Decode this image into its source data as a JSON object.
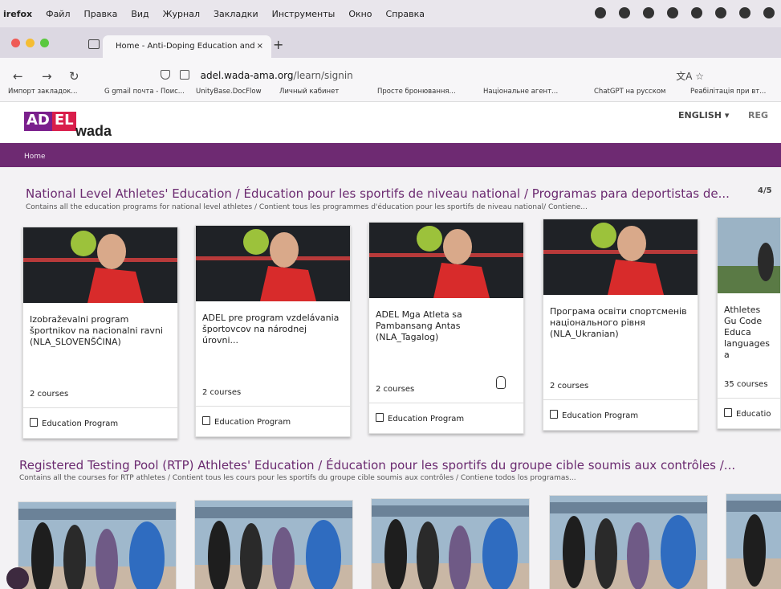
{
  "menubar": {
    "app": "irefox",
    "items": [
      "Файл",
      "Правка",
      "Вид",
      "Журнал",
      "Закладки",
      "Инструменты",
      "Окно",
      "Справка"
    ]
  },
  "browser": {
    "tab_title": "Home - Anti-Doping Education and",
    "tab_close": "×",
    "new_tab": "+",
    "url_host": "adel.wada-ama.org",
    "url_path": "/learn/signin",
    "bookmarks": [
      "Импорт закладок...",
      "G gmail почта - Поис...",
      "UnityBase.DocFlow",
      "Личный кабинет",
      "Просте бронювання...",
      "Національне агент...",
      "ChatGPT на русском",
      "Реабілітація при вт..."
    ]
  },
  "site": {
    "logo_adel_a": "AD",
    "logo_adel_b": "EL",
    "logo_wada": "wada",
    "language": "ENGLISH",
    "register": "REG",
    "breadcrumb": "Home"
  },
  "sections": [
    {
      "title": "National Level Athletes' Education / Éducation pour les sportifs de niveau national / Programas para deportistas de...",
      "subtitle": "Contains all the education programs for national level athletes / Contient tous les programmes d'éducation pour les sportifs de niveau national/ Contiene...",
      "counter": "4/5",
      "cards": [
        {
          "title": "Izobraževalni program športnikov na nacionalni ravni (NLA_SLOVENŠČINA)",
          "count": "2 courses",
          "type": "Education Program"
        },
        {
          "title": "ADEL pre program vzdelávania športovcov na národnej úrovni...",
          "count": "2 courses",
          "type": "Education Program"
        },
        {
          "title": "ADEL Mga Atleta sa Pambansang Antas (NLA_Tagalog)",
          "count": "2 courses",
          "type": "Education Program"
        },
        {
          "title": "Програма освіти спортсменів національного рівня (NLA_Ukranian)",
          "count": "2 courses",
          "type": "Education Program"
        },
        {
          "title": "Athletes Gu Code Educa languages a",
          "count": "35 courses",
          "type": "Educatio"
        }
      ]
    },
    {
      "title": "Registered Testing Pool (RTP) Athletes' Education / Éducation pour les sportifs du groupe cible soumis aux contrôles /...",
      "subtitle": "Contains all the courses for RTP athletes / Contient tous les cours pour les sportifs du groupe cible soumis aux contrôles / Contiene todos los programas..."
    }
  ],
  "colors": {
    "purple": "#6e2a72",
    "title_purple": "#6b2a70",
    "adel_purple": "#7a1f8c",
    "adel_red": "#d91e4b"
  }
}
